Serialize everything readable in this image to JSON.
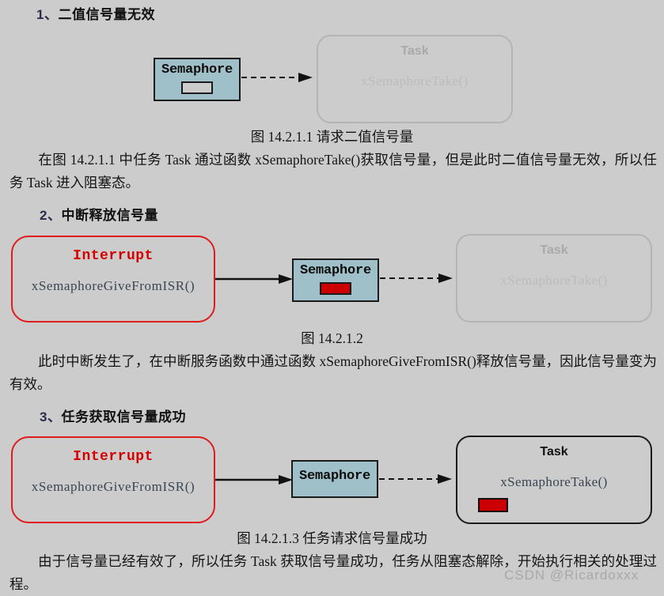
{
  "page": {
    "background_color": "#cccccc",
    "watermark": "CSDN @Ricardoxxx"
  },
  "sections": [
    {
      "number": "1、",
      "title": "二值信号量无效",
      "caption": "图 14.2.1.1  请求二值信号量",
      "paragraph": "在图 14.2.1.1 中任务 Task 通过函数 xSemaphoreTake()获取信号量，但是此时二值信号量无效，所以任务 Task 进入阻塞态。",
      "diagram": {
        "semaphore": {
          "label": "Semaphore",
          "slot_filled": false,
          "fill_color": "#9fc0c8"
        },
        "task": {
          "title": "Task",
          "function": "xSemaphoreTake()",
          "state": "faded",
          "slot_filled": false
        },
        "arrow_style": "dashed"
      }
    },
    {
      "number": "2、",
      "title": "中断释放信号量",
      "caption": "图 14.2.1.2",
      "paragraph": "此时中断发生了，在中断服务函数中通过函数 xSemaphoreGiveFromISR()释放信号量，因此信号量变为有效。",
      "diagram": {
        "interrupt": {
          "title": "Interrupt",
          "function": "xSemaphoreGiveFromISR()",
          "border_color": "#e01b1b",
          "title_color": "#d60000"
        },
        "semaphore": {
          "label": "Semaphore",
          "slot_filled": true,
          "fill_color": "#9fc0c8",
          "slot_color": "#cc0000"
        },
        "task": {
          "title": "Task",
          "function": "xSemaphoreTake()",
          "state": "faded",
          "slot_filled": false
        },
        "arrow_1_style": "solid",
        "arrow_2_style": "dashed"
      }
    },
    {
      "number": "3、",
      "title": "任务获取信号量成功",
      "caption": "图 14.2.1.3  任务请求信号量成功",
      "paragraph": "由于信号量已经有效了，所以任务 Task 获取信号量成功，任务从阻塞态解除，开始执行相关的处理过程。",
      "diagram": {
        "interrupt": {
          "title": "Interrupt",
          "function": "xSemaphoreGiveFromISR()",
          "border_color": "#e01b1b",
          "title_color": "#d60000"
        },
        "semaphore": {
          "label": "Semaphore",
          "slot_filled": false,
          "fill_color": "#9fc0c8"
        },
        "task": {
          "title": "Task",
          "function": "xSemaphoreTake()",
          "state": "active",
          "slot_filled": true,
          "slot_color": "#cc0000"
        },
        "arrow_1_style": "solid",
        "arrow_2_style": "dashed"
      }
    }
  ]
}
